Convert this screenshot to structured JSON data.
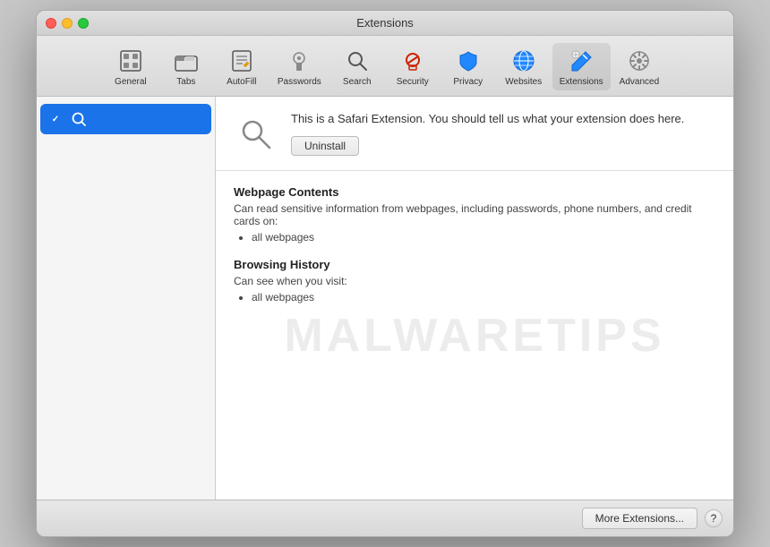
{
  "window": {
    "title": "Extensions"
  },
  "toolbar": {
    "items": [
      {
        "id": "general",
        "label": "General",
        "icon": "general"
      },
      {
        "id": "tabs",
        "label": "Tabs",
        "icon": "tabs"
      },
      {
        "id": "autofill",
        "label": "AutoFill",
        "icon": "autofill"
      },
      {
        "id": "passwords",
        "label": "Passwords",
        "icon": "passwords"
      },
      {
        "id": "search",
        "label": "Search",
        "icon": "search"
      },
      {
        "id": "security",
        "label": "Security",
        "icon": "security"
      },
      {
        "id": "privacy",
        "label": "Privacy",
        "icon": "privacy"
      },
      {
        "id": "websites",
        "label": "Websites",
        "icon": "websites"
      },
      {
        "id": "extensions",
        "label": "Extensions",
        "icon": "extensions",
        "active": true
      },
      {
        "id": "advanced",
        "label": "Advanced",
        "icon": "advanced"
      }
    ]
  },
  "sidebar": {
    "items": [
      {
        "id": "search-ext",
        "label": "Search",
        "checked": true,
        "selected": true
      }
    ]
  },
  "main": {
    "extension": {
      "description": "This is a Safari Extension. You should tell us what your extension does here.",
      "uninstall_button": "Uninstall"
    },
    "permissions": [
      {
        "title": "Webpage Contents",
        "description": "Can read sensitive information from webpages, including passwords, phone numbers, and credit cards on:",
        "items": [
          "all webpages"
        ]
      },
      {
        "title": "Browsing History",
        "description": "Can see when you visit:",
        "items": [
          "all webpages"
        ]
      }
    ]
  },
  "footer": {
    "more_extensions": "More Extensions...",
    "help": "?"
  },
  "watermark": {
    "text": "MALWARETIPS"
  }
}
